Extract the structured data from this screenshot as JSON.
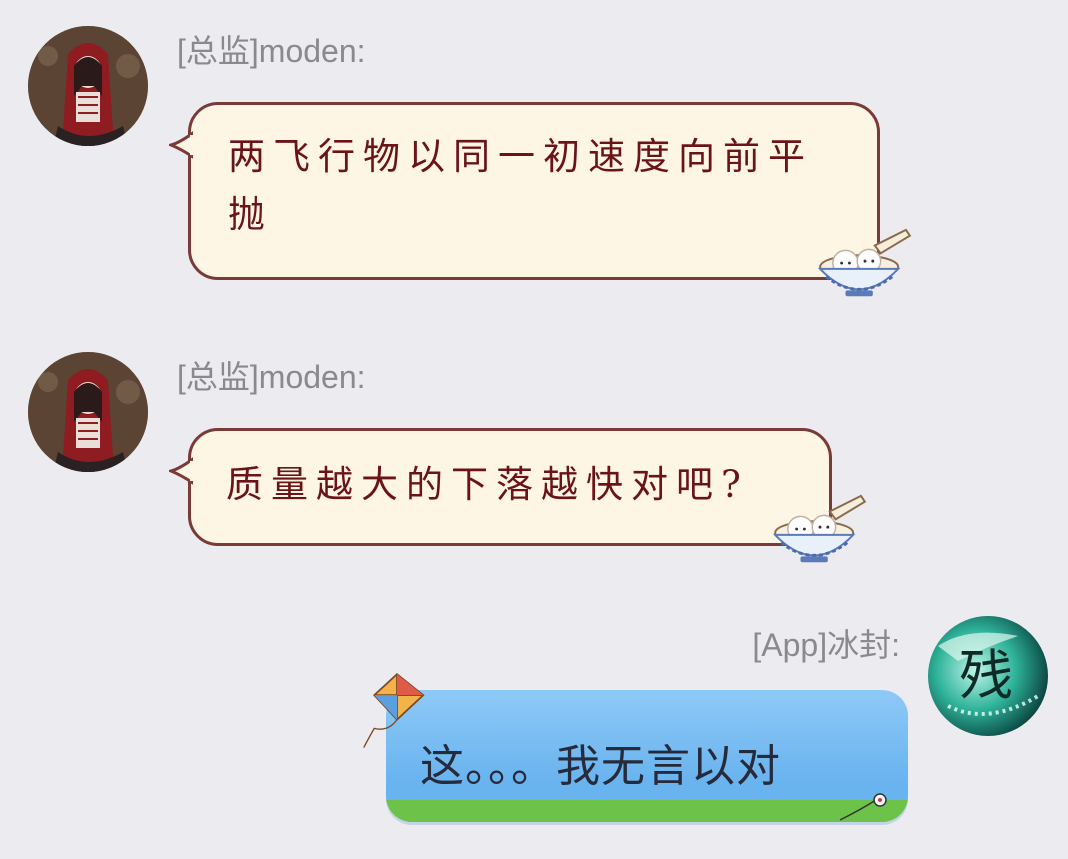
{
  "messages": [
    {
      "sender": "[总监]moden:",
      "text_line1": "两飞行物以同一初速度向前平",
      "text_line2": "抛",
      "side": "left",
      "bubble_theme": "cream-tangyuan"
    },
    {
      "sender": "[总监]moden:",
      "text": "质量越大的下落越快对吧?",
      "side": "left",
      "bubble_theme": "cream-tangyuan"
    },
    {
      "sender": "[App]冰封:",
      "text": "这。。。我无言以对",
      "side": "right",
      "bubble_theme": "blue-kite",
      "avatar_glyph": "残"
    }
  ],
  "colors": {
    "background": "#ebebf0",
    "cream_bubble": "#fdf6e4",
    "cream_border": "#7a3a38",
    "cream_text": "#6b1418",
    "blue_bubble": "#69b3ef",
    "sender_text": "#8a8a8e"
  },
  "icons": [
    "avatar-moden",
    "avatar-bingfeng",
    "tangyuan-bowl-icon",
    "kite-icon"
  ]
}
